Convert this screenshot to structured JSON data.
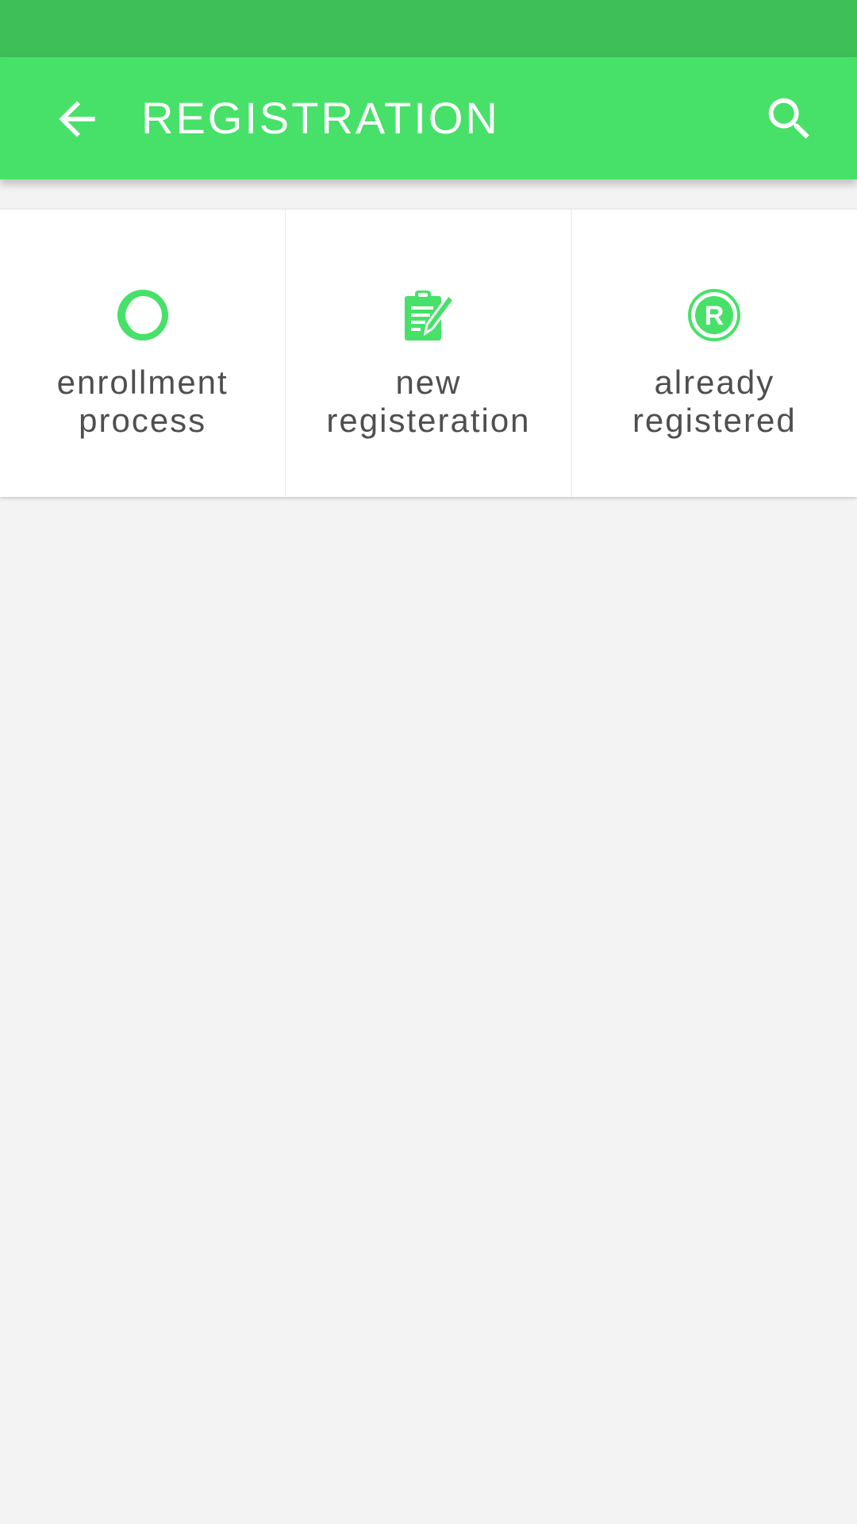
{
  "colors": {
    "status_bar": "#3fbf58",
    "app_bar": "#47e169",
    "accent": "#47e169",
    "background": "#f3f3f3",
    "tile_text": "#4f4f4f"
  },
  "app_bar": {
    "title": "REGISTRATION",
    "back_icon": "arrow-left-icon",
    "search_icon": "search-icon"
  },
  "tiles": [
    {
      "id": "enrollment-process",
      "icon": "ring-progress-icon",
      "label": "enrollment\nprocess"
    },
    {
      "id": "new-registeration",
      "icon": "clipboard-edit-icon",
      "label": "new\nregisteration"
    },
    {
      "id": "already-registered",
      "icon": "registered-icon",
      "label": "already\nregistered"
    }
  ]
}
